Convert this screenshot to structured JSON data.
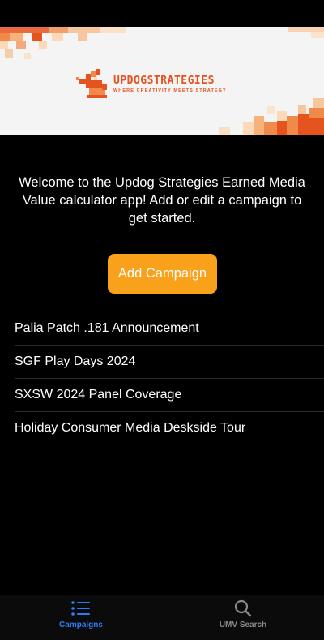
{
  "banner": {
    "brand_name": "UPDOGSTRATEGIES",
    "tagline": "WHERE CREATIVITY MEETS STRATEGY",
    "colors": {
      "primary": "#e5531f",
      "light": "#f7b27a",
      "background": "#f4f4f4"
    }
  },
  "welcome": {
    "text": "Welcome to the Updog Strategies Earned Media Value calculator app! Add or edit a campaign to get started."
  },
  "add_button": {
    "label": "Add Campaign",
    "color": "#f9a11b"
  },
  "campaigns": [
    {
      "name": "Palia Patch .181 Announcement"
    },
    {
      "name": "SGF Play Days 2024"
    },
    {
      "name": "SXSW 2024 Panel Coverage"
    },
    {
      "name": "Holiday Consumer Media Deskside Tour"
    }
  ],
  "tabbar": {
    "tabs": [
      {
        "label": "Campaigns",
        "icon": "list-icon",
        "active": true
      },
      {
        "label": "UMV Search",
        "icon": "search-icon",
        "active": false
      }
    ],
    "colors": {
      "active": "#2f7bf6",
      "inactive": "#8a8a8e"
    }
  }
}
